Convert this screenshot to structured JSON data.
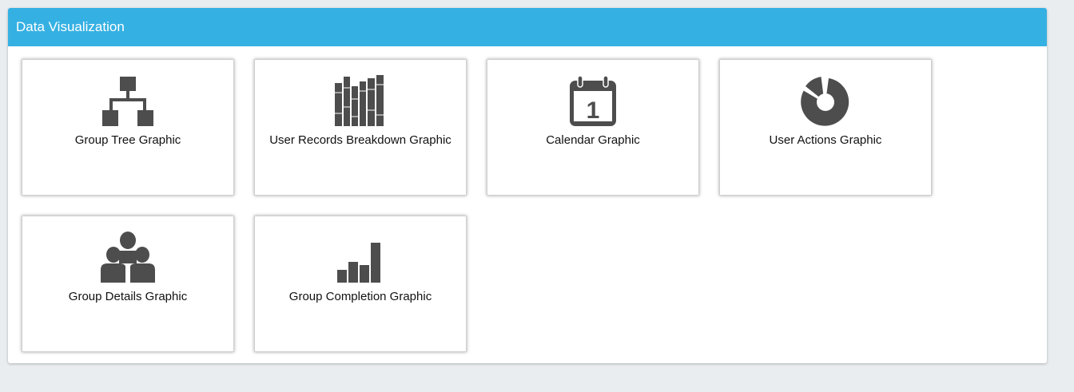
{
  "panel": {
    "title": "Data Visualization",
    "header_color": "#35b0e2"
  },
  "tiles": [
    {
      "label": "Group Tree Graphic",
      "icon": "sitemap-icon"
    },
    {
      "label": "User Records Breakdown Graphic",
      "icon": "books-icon"
    },
    {
      "label": "Calendar Graphic",
      "icon": "calendar-icon",
      "calendar_day": "1"
    },
    {
      "label": "User Actions Graphic",
      "icon": "donut-chart-icon"
    },
    {
      "label": "Group Details Graphic",
      "icon": "group-users-icon"
    },
    {
      "label": "Group Completion Graphic",
      "icon": "bar-chart-icon"
    }
  ],
  "colors": {
    "icon": "#4d4d4d",
    "background": "#e9edf0"
  }
}
